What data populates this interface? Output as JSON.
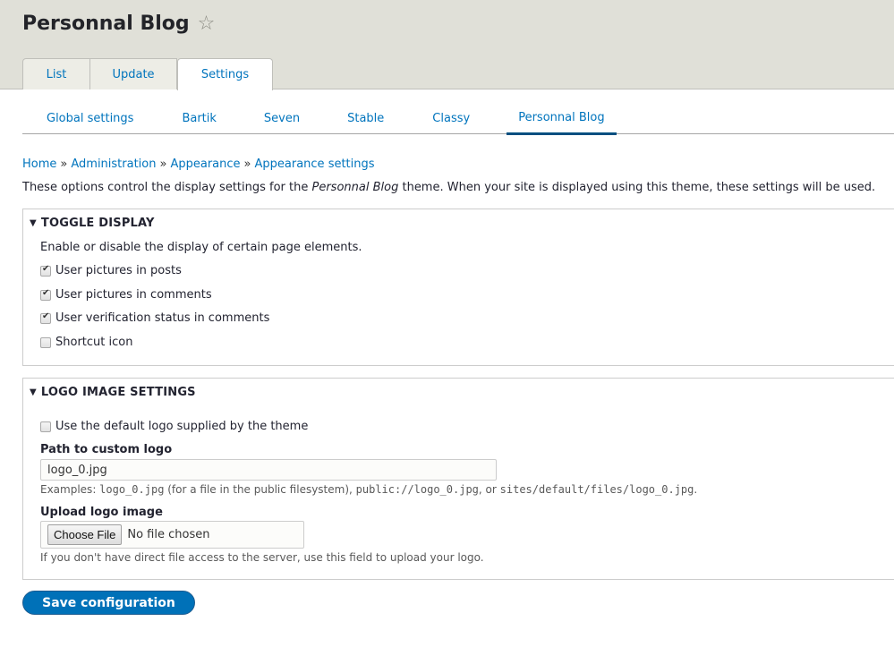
{
  "header": {
    "title": "Personnal Blog",
    "favorite_icon": "star-outline-icon"
  },
  "primary_tabs": [
    {
      "label": "List",
      "active": false
    },
    {
      "label": "Update",
      "active": false
    },
    {
      "label": "Settings",
      "active": true
    }
  ],
  "secondary_tabs": [
    {
      "label": "Global settings",
      "active": false
    },
    {
      "label": "Bartik",
      "active": false
    },
    {
      "label": "Seven",
      "active": false
    },
    {
      "label": "Stable",
      "active": false
    },
    {
      "label": "Classy",
      "active": false
    },
    {
      "label": "Personnal Blog",
      "active": true
    }
  ],
  "breadcrumb": {
    "separator": "»",
    "items": [
      "Home",
      "Administration",
      "Appearance",
      "Appearance settings"
    ]
  },
  "description": {
    "before": "These options control the display settings for the ",
    "theme_name": "Personnal Blog",
    "after": " theme. When your site is displayed using this theme, these settings will be used."
  },
  "toggle_display": {
    "title": "Toggle display",
    "expanded": true,
    "description": "Enable or disable the display of certain page elements.",
    "options": [
      {
        "label": "User pictures in posts",
        "checked": true
      },
      {
        "label": "User pictures in comments",
        "checked": true
      },
      {
        "label": "User verification status in comments",
        "checked": true
      },
      {
        "label": "Shortcut icon",
        "checked": false
      }
    ]
  },
  "logo_settings": {
    "title": "Logo image settings",
    "expanded": true,
    "default_logo": {
      "label": "Use the default logo supplied by the theme",
      "checked": false
    },
    "path": {
      "label": "Path to custom logo",
      "value": "logo_0.jpg",
      "help_prefix": "Examples: ",
      "help_code1": "logo_0.jpg",
      "help_mid1": " (for a file in the public filesystem), ",
      "help_code2": "public://logo_0.jpg",
      "help_mid2": ", or ",
      "help_code3": "sites/default/files/logo_0.jpg",
      "help_suffix": "."
    },
    "upload": {
      "label": "Upload logo image",
      "button": "Choose File",
      "status": "No file chosen",
      "help": "If you don't have direct file access to the server, use this field to upload your logo."
    }
  },
  "actions": {
    "save_label": "Save configuration"
  },
  "colors": {
    "link": "#0074bd",
    "primary_button": "#0071b8",
    "header_bg": "#e0e0d8",
    "active_tab_underline": "#004f80"
  }
}
